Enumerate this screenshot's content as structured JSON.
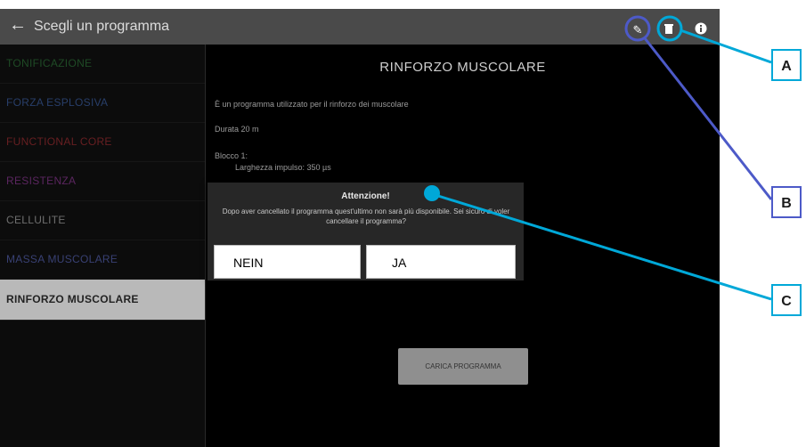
{
  "header": {
    "back_icon": "arrow-left-icon",
    "title": "Scegli un programma",
    "actions": [
      "edit-icon",
      "delete-icon",
      "info-icon"
    ]
  },
  "sidebar": {
    "items": [
      {
        "label": "TONIFICAZIONE",
        "color": "#2e7d3a"
      },
      {
        "label": "FORZA ESPLOSIVA",
        "color": "#3f67b5"
      },
      {
        "label": "FUNCTIONAL CORE",
        "color": "#b02e33"
      },
      {
        "label": "RESISTENZA",
        "color": "#9b3ba3"
      },
      {
        "label": "CELLULITE",
        "color": "#bdbdbd"
      },
      {
        "label": "MASSA MUSCOLARE",
        "color": "#5d6bc8"
      },
      {
        "label": "RINFORZO MUSCOLARE",
        "color": "#222222"
      }
    ]
  },
  "main": {
    "heading": "RINFORZO MUSCOLARE",
    "description": "È un programma utilizzato per il rinforzo dei muscolare",
    "durata": "Durata 20 m",
    "blocco": "Blocco 1:",
    "larghezza": "Larghezza impulso: 350 µs",
    "carica_button": "CARICA PROGRAMMA"
  },
  "dialog": {
    "title": "Attenzione!",
    "body": "Dopo aver cancellato il programma quest'ultimo non sarà più disponibile. Sei sicuro di voler cancellare il programma?",
    "nein": "NEIN",
    "ja": "JA"
  },
  "callouts": {
    "a": "A",
    "b": "B",
    "c": "C"
  },
  "colors": {
    "callout_cyan": "#00a8d8",
    "callout_blue": "#4d5ac8"
  }
}
